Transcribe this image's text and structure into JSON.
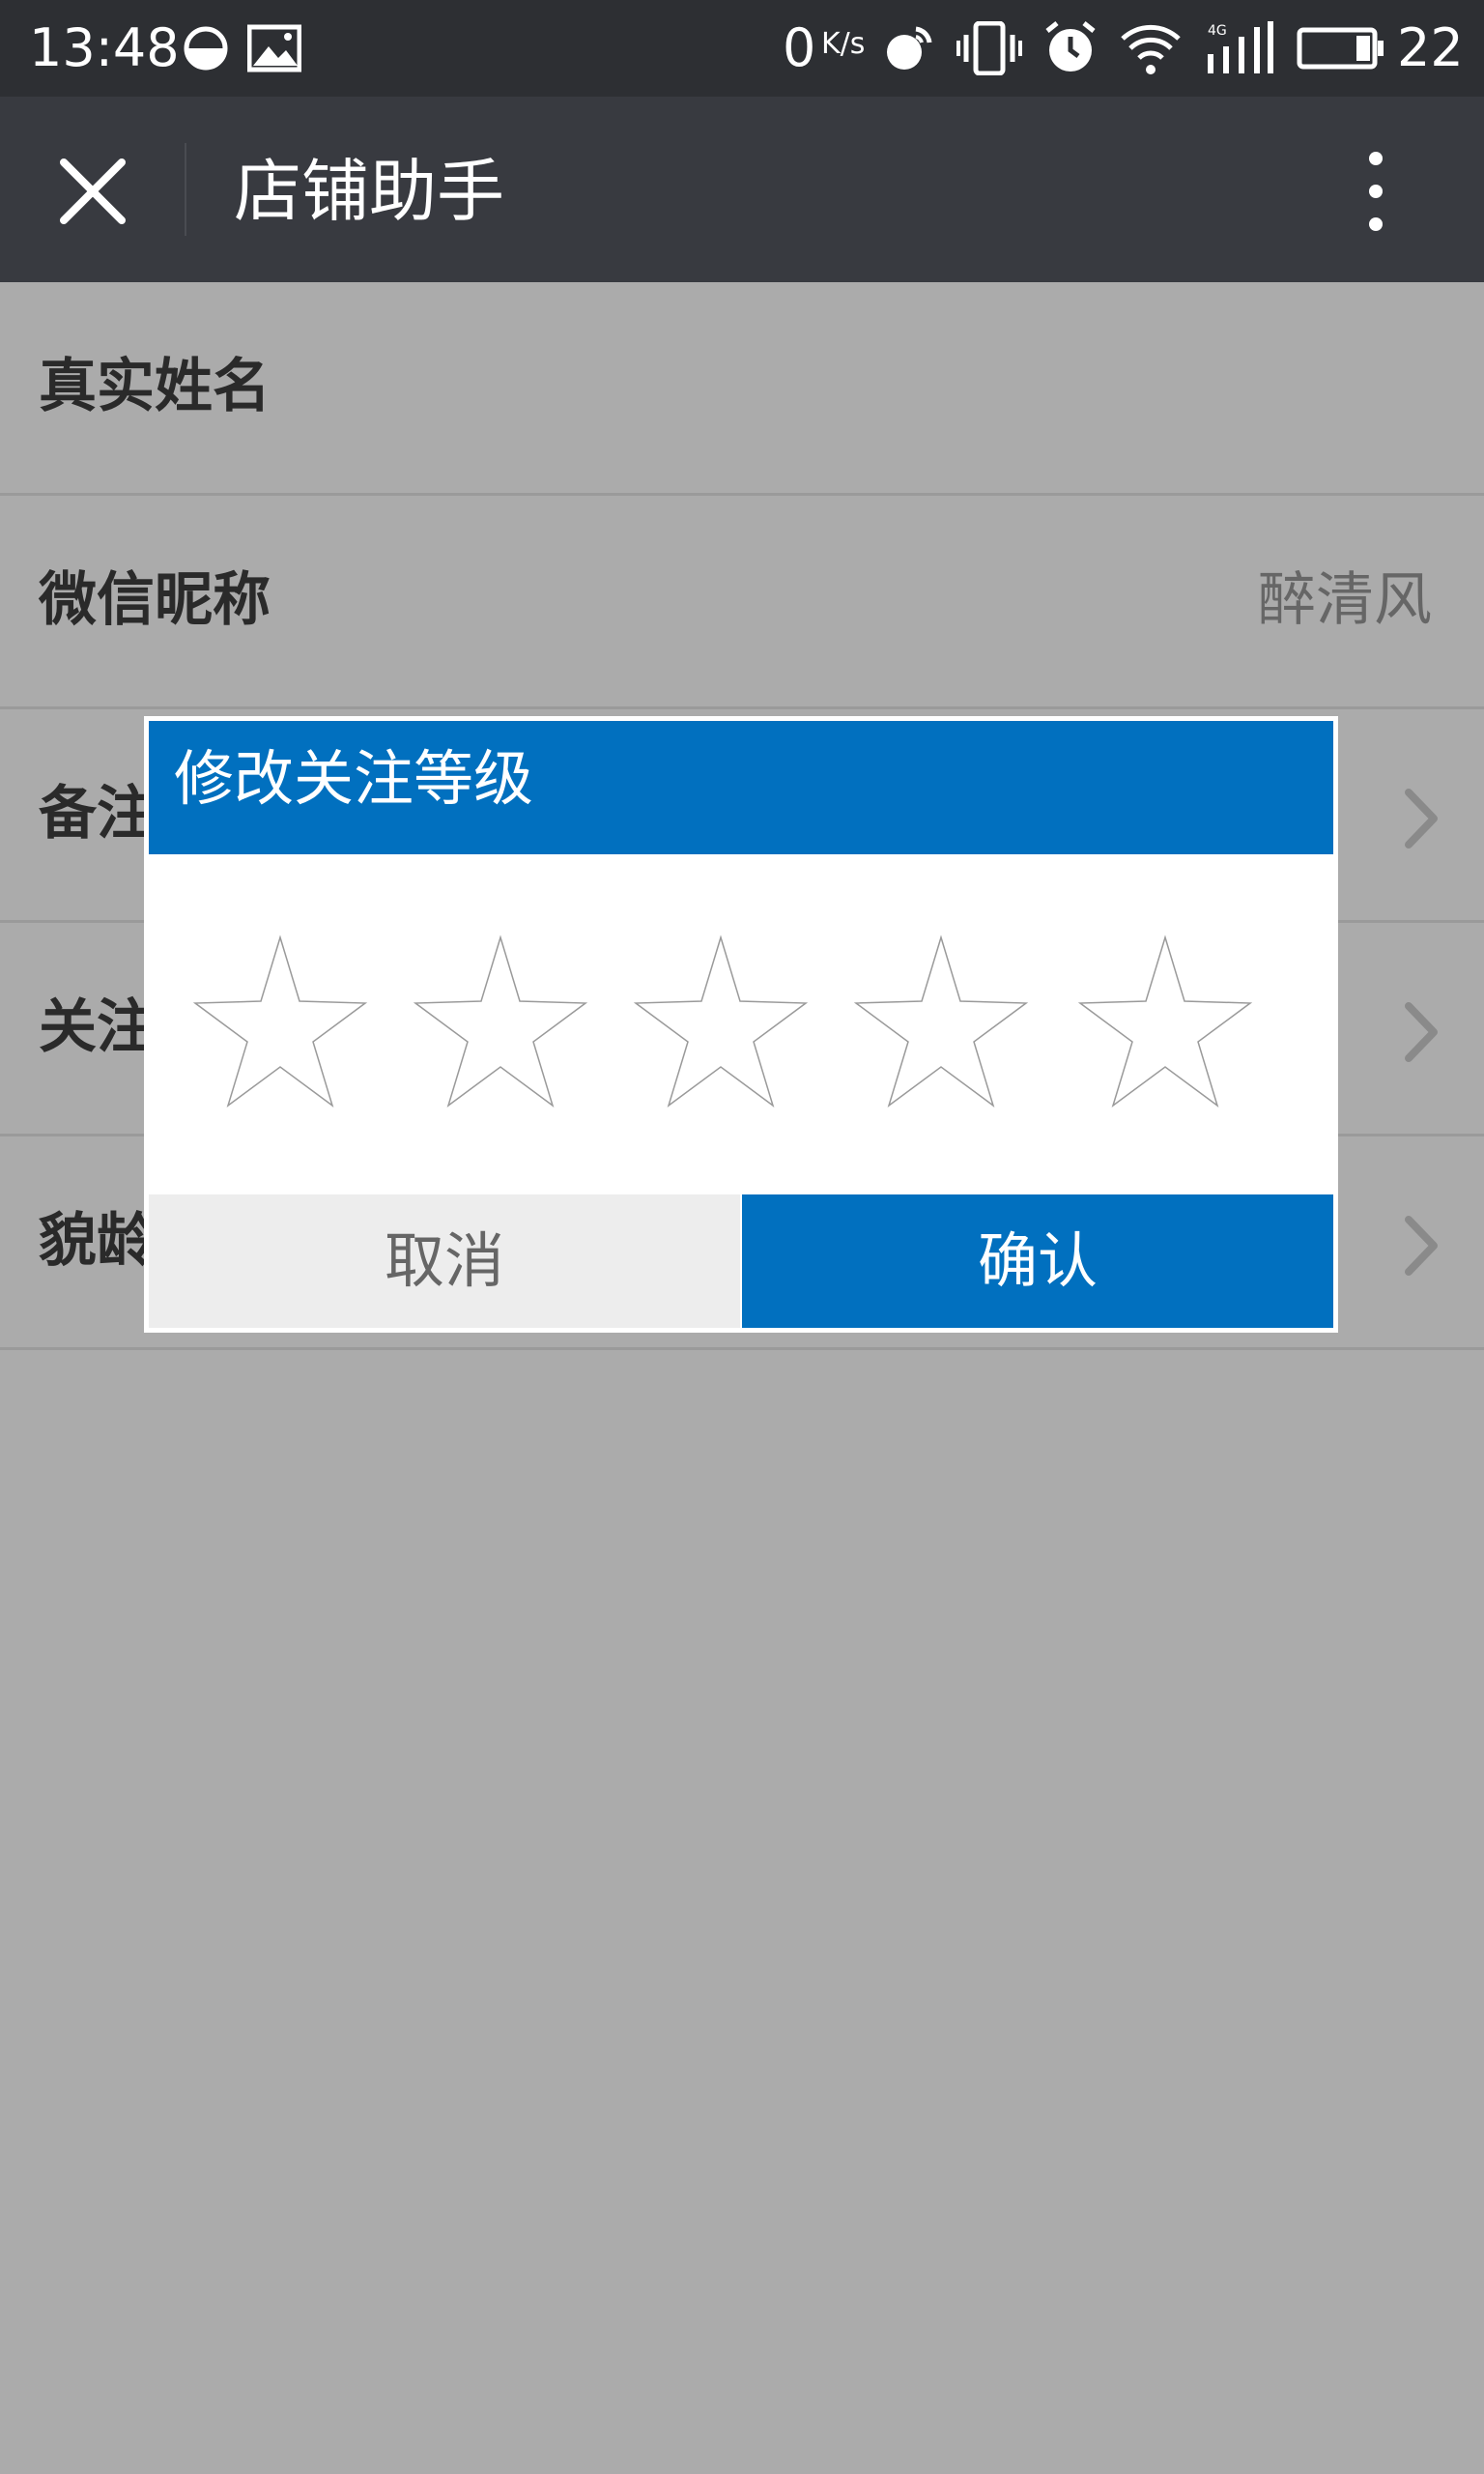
{
  "status_bar": {
    "time": "13:48",
    "net_speed_value": "0",
    "net_speed_unit": "K/s",
    "battery_level": "22",
    "icons": [
      "data-saver-icon",
      "image-icon",
      "speed-icon",
      "sync-icon",
      "vibrate-icon",
      "alarm-icon",
      "wifi-icon",
      "signal-4g-icon",
      "battery-icon"
    ]
  },
  "title_bar": {
    "title": "店铺助手",
    "close_icon": "close-icon",
    "more_icon": "more-vertical-icon"
  },
  "list": {
    "rows": [
      {
        "label": "真实姓名",
        "value": ""
      },
      {
        "label": "微信昵称",
        "value": "醉清风"
      },
      {
        "label": "备注",
        "value": ""
      },
      {
        "label": "关注",
        "value": ""
      },
      {
        "label": "貌龄",
        "value": ""
      }
    ]
  },
  "dialog": {
    "title": "修改关注等级",
    "rating": 0,
    "max_rating": 5,
    "cancel_label": "取消",
    "confirm_label": "确认",
    "accent_color": "#0170bf"
  }
}
